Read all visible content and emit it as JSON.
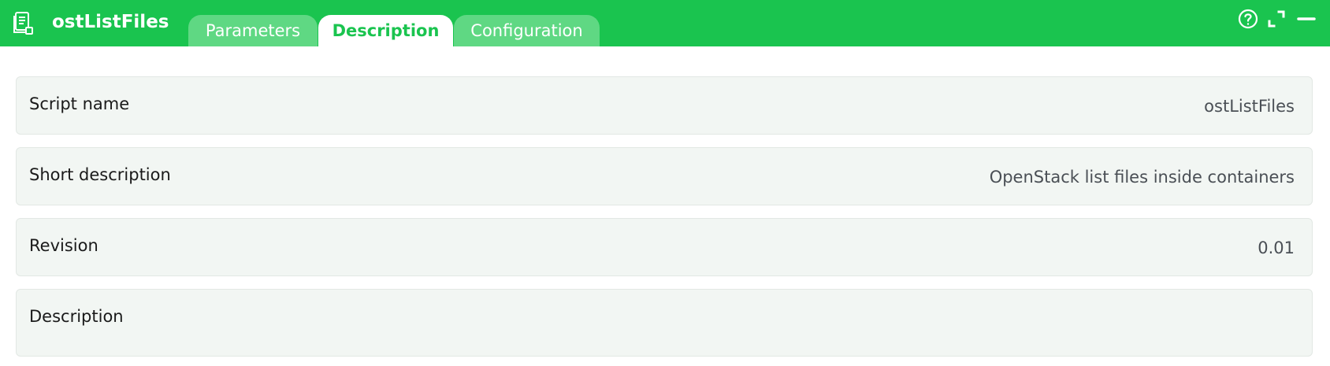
{
  "window": {
    "title": "ostListFiles",
    "icon": "script-document-icon",
    "controls": [
      "help-icon",
      "expand-icon",
      "minimize-icon"
    ]
  },
  "tabs": [
    {
      "label": "Parameters",
      "active": false
    },
    {
      "label": "Description",
      "active": true
    },
    {
      "label": "Configuration",
      "active": false
    }
  ],
  "fields": [
    {
      "label": "Script name",
      "value": "ostListFiles"
    },
    {
      "label": "Short description",
      "value": "OpenStack list files inside containers"
    },
    {
      "label": "Revision",
      "value": "0.01"
    },
    {
      "label": "Description",
      "value": ""
    }
  ],
  "colors": {
    "accent": "#1ac44f",
    "tab_inactive": "#5fd883",
    "row_background": "#f2f6f3"
  }
}
